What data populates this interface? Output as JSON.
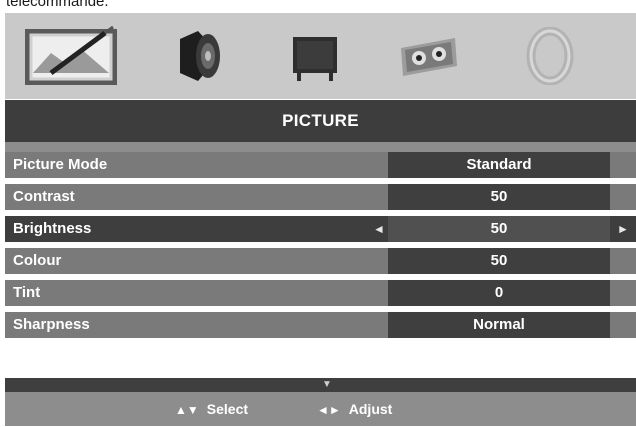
{
  "caption": "telecommande.",
  "menu_icons": [
    {
      "name": "picture-icon",
      "selected": true
    },
    {
      "name": "sound-icon",
      "selected": false
    },
    {
      "name": "screen-icon",
      "selected": false
    },
    {
      "name": "features-icon",
      "selected": false
    },
    {
      "name": "setup-icon",
      "selected": false
    }
  ],
  "title": "PICTURE",
  "rows": [
    {
      "label": "Picture Mode",
      "value": "Standard",
      "selected": false
    },
    {
      "label": "Contrast",
      "value": "50",
      "selected": false
    },
    {
      "label": "Brightness",
      "value": "50",
      "selected": true
    },
    {
      "label": "Colour",
      "value": "50",
      "selected": false
    },
    {
      "label": "Tint",
      "value": "0",
      "selected": false
    },
    {
      "label": "Sharpness",
      "value": "Normal",
      "selected": false
    }
  ],
  "arrows": {
    "left": "◄",
    "right": "►",
    "more": "▼"
  },
  "footer": {
    "select_glyph": "▲▼",
    "select_label": "Select",
    "adjust_glyph": "◄►",
    "adjust_label": "Adjust"
  },
  "colors": {
    "icon_bar": "#c9c9c9",
    "title_bar": "#3d3d3d",
    "row": "#7a7a7a",
    "row_selected": "#3e3e3e",
    "value_box": "#3f3f3f"
  }
}
